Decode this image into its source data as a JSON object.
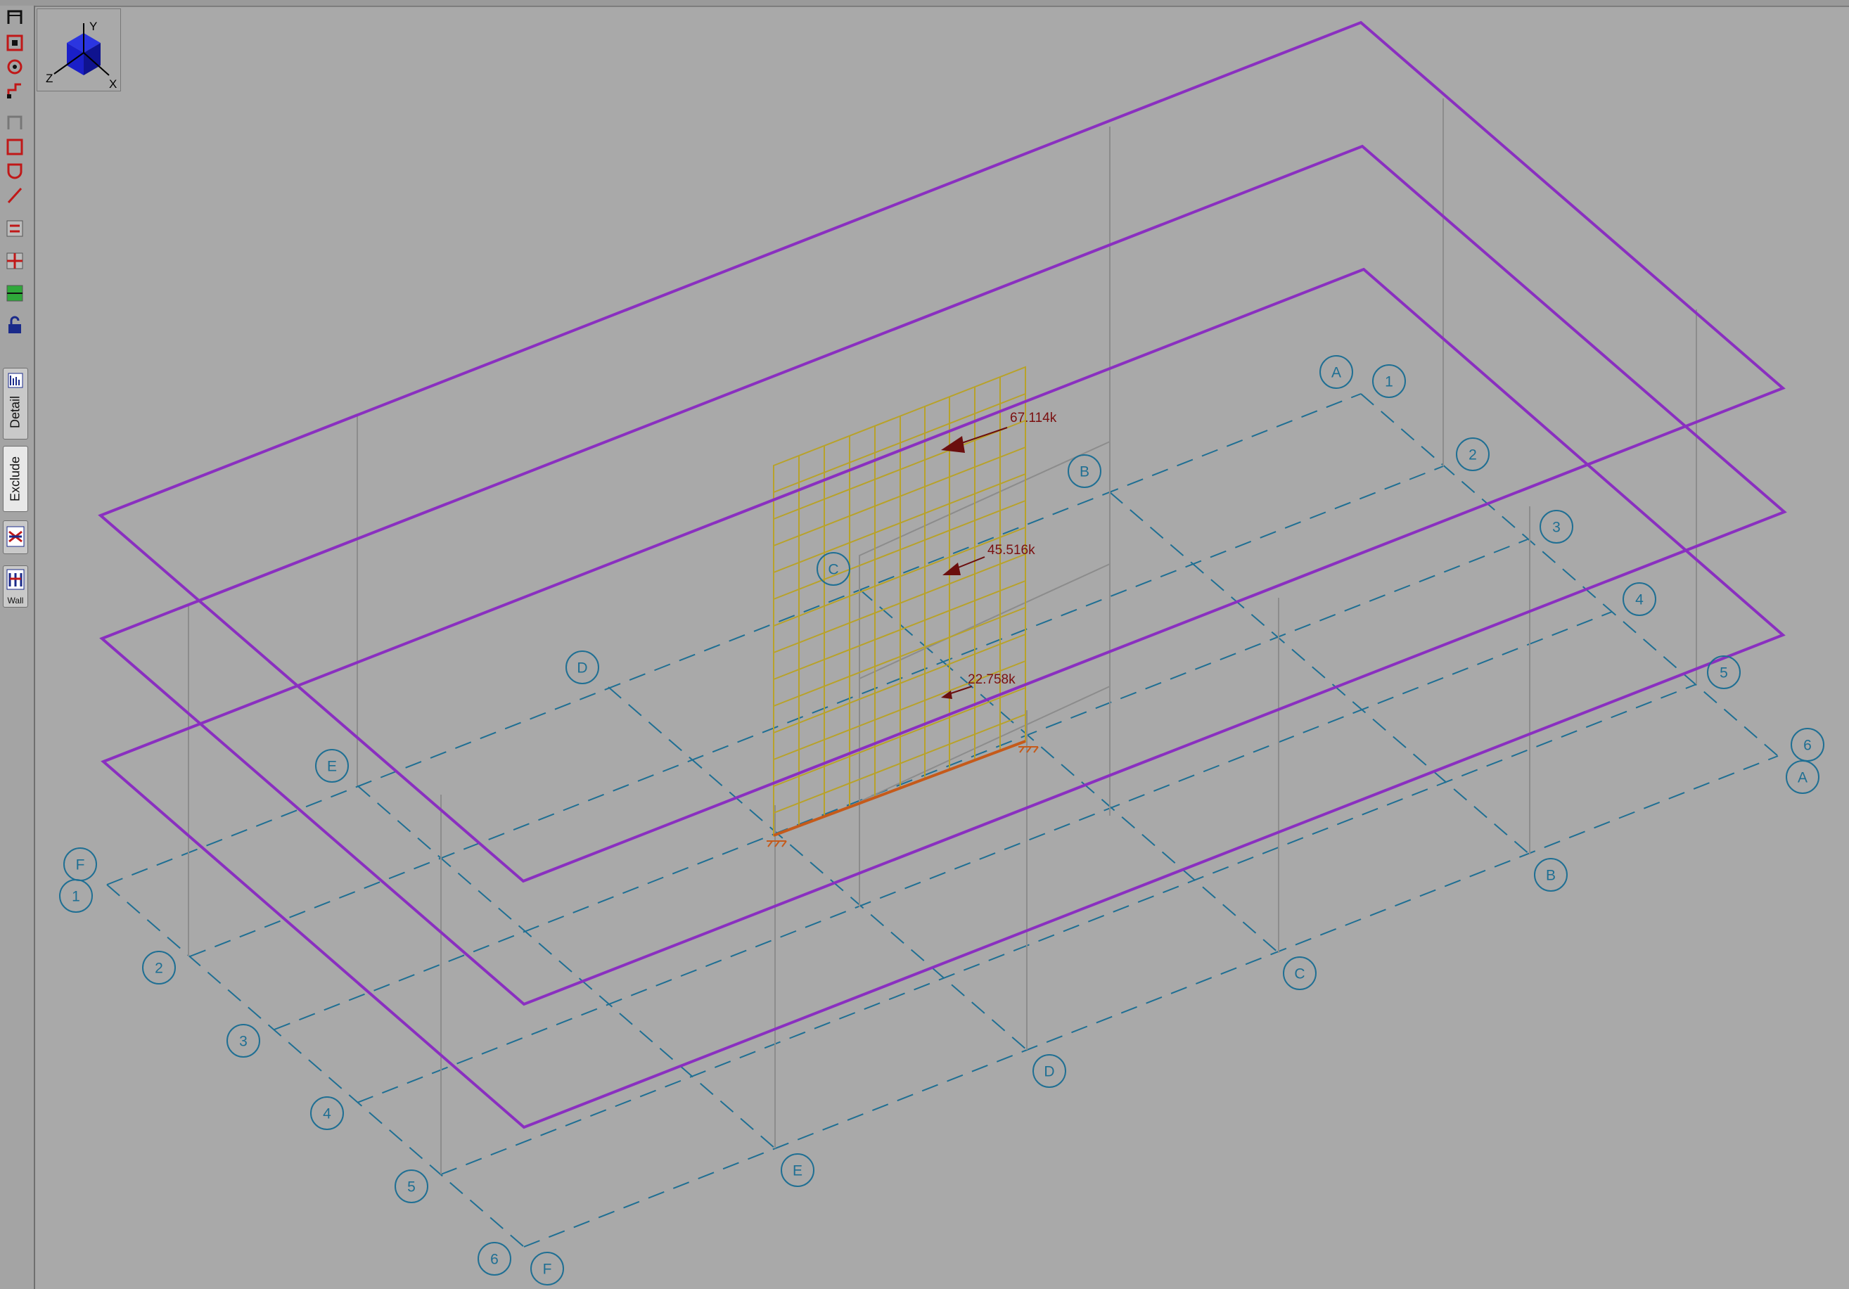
{
  "toolbar": {
    "tabs": [
      {
        "label": "Detail"
      },
      {
        "label": "Exclude"
      },
      {
        "label": "Wall"
      }
    ],
    "icons": [
      "frame-icon",
      "shell-icon",
      "circle-shell-icon",
      "link-icon",
      "frame-outline-icon",
      "area-icon",
      "round-area-icon",
      "line-icon",
      "swap-icon",
      "mesh-icon",
      "green-mesh-icon",
      "lock-icon",
      "detail-icon",
      "beam-icon",
      "wall-icon"
    ]
  },
  "view_cube": {
    "x_label": "X",
    "y_label": "Y",
    "z_label": "Z",
    "cube_color": "#1a1fc8"
  },
  "grid_bubbles": {
    "top_right_letters": [
      "A",
      "B",
      "C",
      "D",
      "E",
      "F"
    ],
    "top_right_numbers": [
      "1",
      "2",
      "3",
      "4",
      "5",
      "6"
    ],
    "bottom_left_numbers": [
      "1",
      "2",
      "3",
      "4",
      "5",
      "6"
    ],
    "bottom_right_letters": [
      "A",
      "B",
      "C",
      "D",
      "E",
      "F"
    ],
    "color": "#1f6f93"
  },
  "loads": [
    {
      "label": "67.114k"
    },
    {
      "label": "45.516k"
    },
    {
      "label": "22.758k"
    }
  ],
  "colors": {
    "slab": "#8a2fc0",
    "grid": "#1f6f93",
    "wall_mesh": "#b8a22a",
    "wall_base": "#c55a1a",
    "load": "#6b0e0e",
    "column": "#888888"
  }
}
